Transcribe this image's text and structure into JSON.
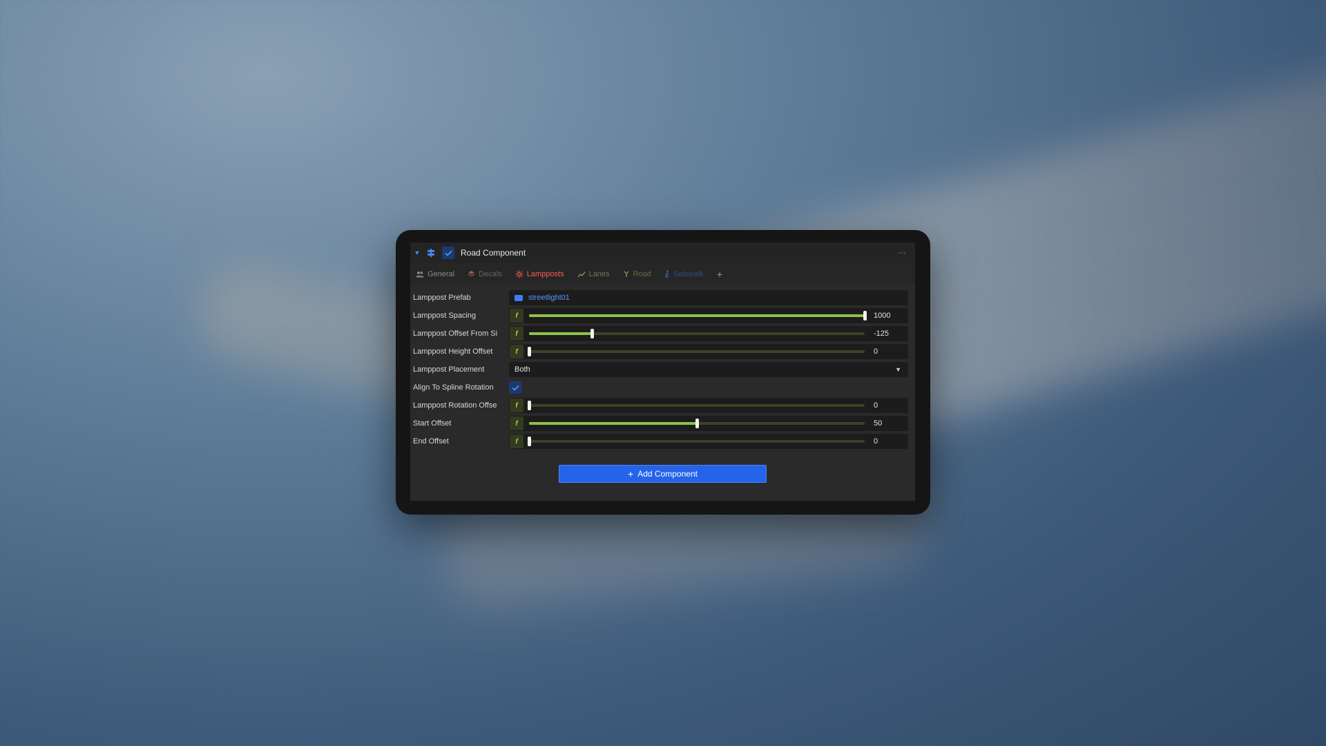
{
  "component": {
    "title": "Road Component",
    "enabled": true
  },
  "tabs": [
    {
      "label": "General",
      "icon": "people-icon",
      "color": "#8b8b8b"
    },
    {
      "label": "Decals",
      "icon": "layers-icon",
      "color": "#6e6259"
    },
    {
      "label": "Lampposts",
      "icon": "sun-icon",
      "color": "#ff5b4f",
      "active": true
    },
    {
      "label": "Lanes",
      "icon": "chart-line-icon",
      "color": "#6a7a57"
    },
    {
      "label": "Road",
      "icon": "road-icon",
      "color": "#6b6b45"
    },
    {
      "label": "Sidewalk",
      "icon": "walk-icon",
      "color": "#2d4a86"
    }
  ],
  "properties": {
    "prefab": {
      "label": "Lamppost Prefab",
      "value": "streetlight01"
    },
    "spacing": {
      "label": "Lamppost Spacing",
      "value": "1000",
      "fraction": 1.0
    },
    "offset_side": {
      "label": "Lamppost Offset From Si",
      "value": "-125",
      "fraction": 0.1875
    },
    "height_offset": {
      "label": "Lamppost Height Offset",
      "value": "0",
      "fraction": 0.0
    },
    "placement": {
      "label": "Lamppost Placement",
      "value": "Both"
    },
    "align_spline": {
      "label": "Align To Spline Rotation",
      "checked": true
    },
    "rotation_offset": {
      "label": "Lamppost Rotation Offse",
      "value": "0",
      "fraction": 0.0
    },
    "start_offset": {
      "label": "Start Offset",
      "value": "50",
      "fraction": 0.5
    },
    "end_offset": {
      "label": "End Offset",
      "value": "0",
      "fraction": 0.0
    }
  },
  "float_badge": "f",
  "add_component": {
    "label": "Add Component"
  },
  "colors": {
    "accent": "#2563e8",
    "slider_fill": "#8fc14a",
    "active_tab": "#ff5b4f"
  }
}
